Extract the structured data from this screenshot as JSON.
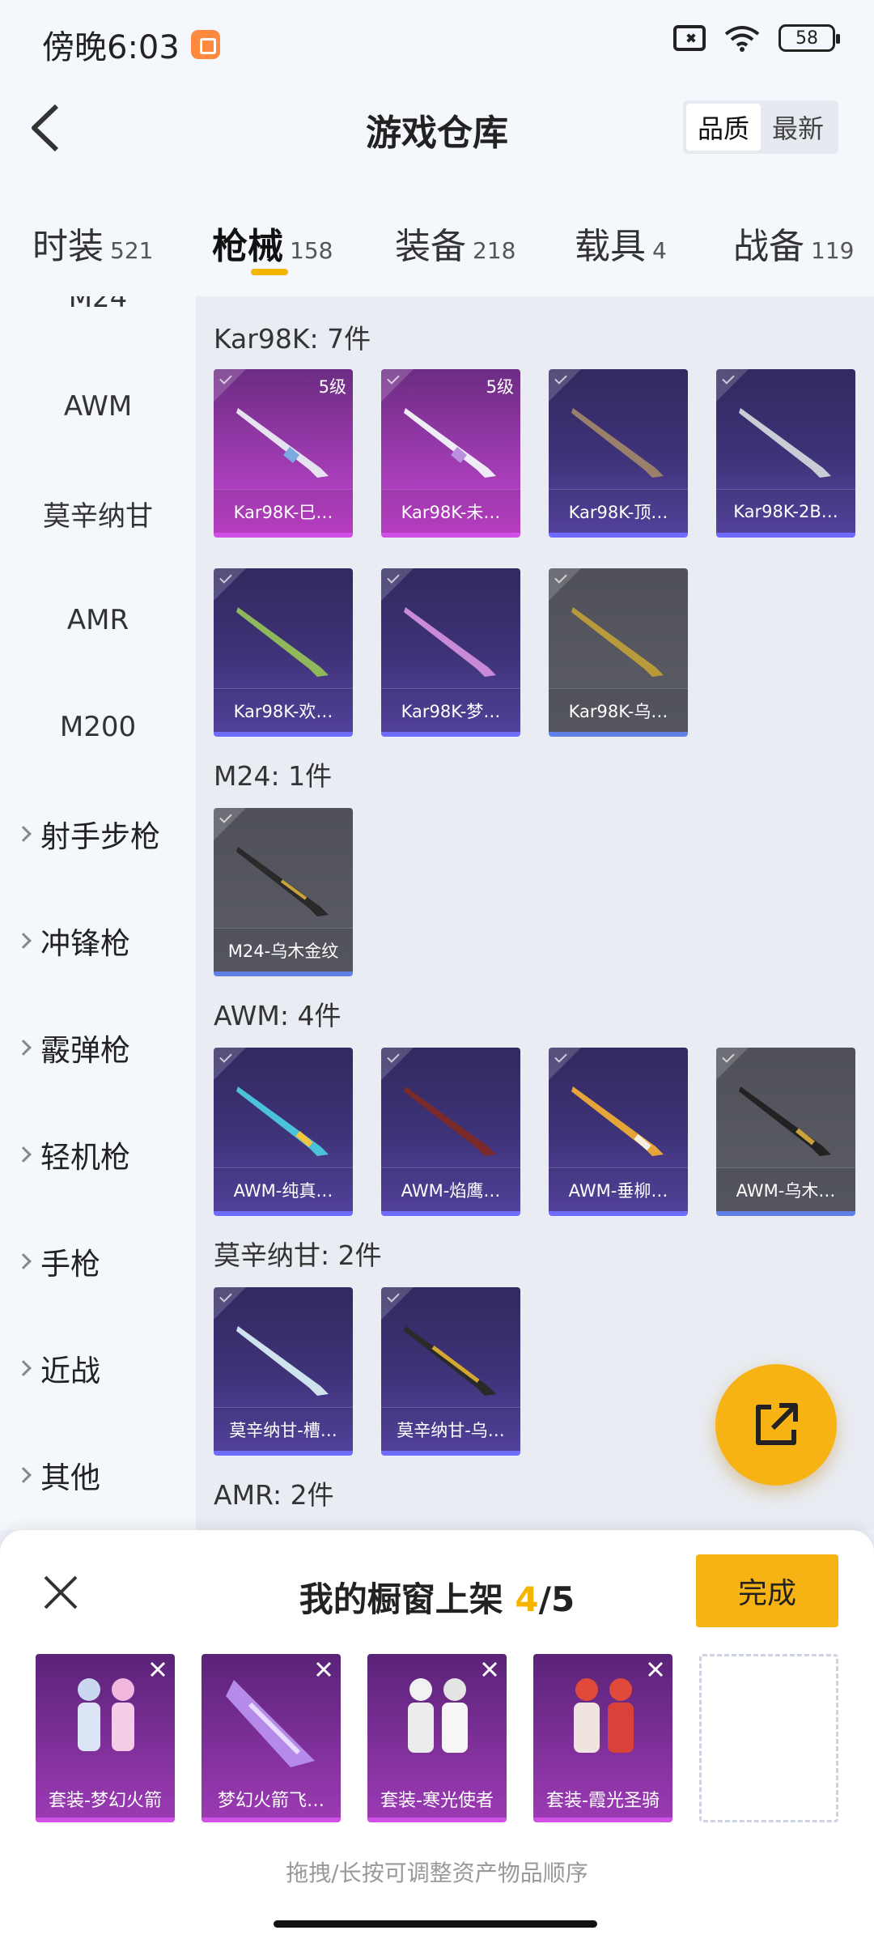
{
  "status_bar": {
    "time": "傍晚6:03",
    "battery": "58"
  },
  "header": {
    "title": "游戏仓库",
    "sort_options": [
      "品质",
      "最新"
    ],
    "active_sort": "品质"
  },
  "tabs": [
    {
      "label": "时装",
      "count": "521"
    },
    {
      "label": "枪械",
      "count": "158"
    },
    {
      "label": "装备",
      "count": "218"
    },
    {
      "label": "载具",
      "count": "4"
    },
    {
      "label": "战备",
      "count": "119"
    }
  ],
  "active_tab": "枪械",
  "sidebar": {
    "sub_items": [
      "M24",
      "AWM",
      "莫辛纳甘",
      "AMR",
      "M200"
    ],
    "groups": [
      "射手步枪",
      "冲锋枪",
      "霰弹枪",
      "轻机枪",
      "手枪",
      "近战",
      "其他"
    ]
  },
  "sections": [
    {
      "title": "Kar98K: 7件",
      "items": [
        {
          "name": "Kar98K-巳…",
          "level": "5级",
          "rarity": "magenta"
        },
        {
          "name": "Kar98K-未…",
          "level": "5级",
          "rarity": "magenta"
        },
        {
          "name": "Kar98K-顶…",
          "rarity": "purple"
        },
        {
          "name": "Kar98K-2B…",
          "rarity": "purple"
        },
        {
          "name": "Kar98K-欢…",
          "rarity": "purple"
        },
        {
          "name": "Kar98K-梦…",
          "rarity": "purple"
        },
        {
          "name": "Kar98K-乌…",
          "rarity": "gray"
        }
      ]
    },
    {
      "title": "M24: 1件",
      "items": [
        {
          "name": "M24-乌木金纹",
          "rarity": "gray"
        }
      ]
    },
    {
      "title": "AWM: 4件",
      "items": [
        {
          "name": "AWM-纯真…",
          "rarity": "purple"
        },
        {
          "name": "AWM-焰鹰…",
          "rarity": "purple"
        },
        {
          "name": "AWM-垂柳…",
          "rarity": "purple"
        },
        {
          "name": "AWM-乌木…",
          "rarity": "gray"
        }
      ]
    },
    {
      "title": "莫辛纳甘: 2件",
      "items": [
        {
          "name": "莫辛纳甘-槽…",
          "rarity": "purple"
        },
        {
          "name": "莫辛纳甘-乌…",
          "rarity": "purple"
        }
      ]
    },
    {
      "title": "AMR: 2件",
      "items": []
    }
  ],
  "showcase": {
    "title": "我的橱窗上架",
    "current": "4",
    "total": "/5",
    "done_label": "完成",
    "slots": [
      "套装-梦幻火箭",
      "梦幻火箭飞…",
      "套装-寒光使者",
      "套装-霞光圣骑"
    ],
    "hint": "拖拽/长按可调整资产物品顺序"
  },
  "colors": {
    "accent": "#f7b313",
    "purple_card": "#3f3379",
    "magenta_card": "#a13cb3",
    "gray_card": "#5c5d66"
  }
}
